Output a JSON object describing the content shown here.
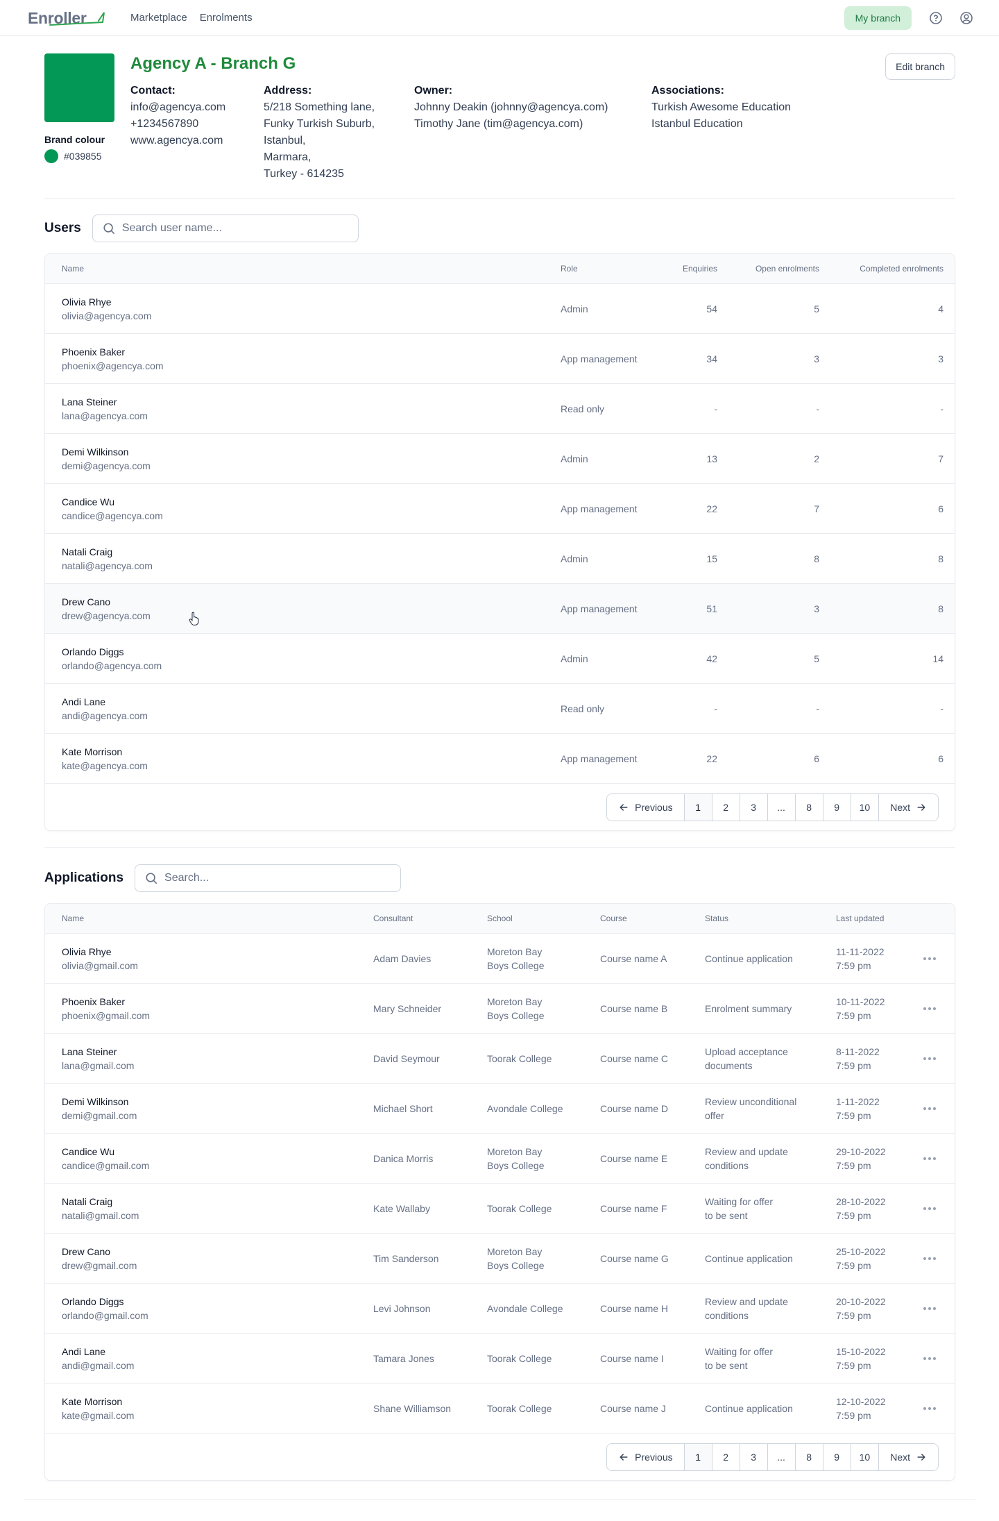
{
  "nav": {
    "logo": "Enroller",
    "links": [
      "Marketplace",
      "Enrolments"
    ],
    "branch_button": "My branch",
    "help_icon": "help-circle-icon",
    "user_icon": "user-circle-icon"
  },
  "branch": {
    "title": "Agency A - Branch G",
    "brand_colour_label": "Brand colour",
    "brand_colour": "#039855",
    "edit_button": "Edit branch",
    "contact": {
      "label": "Contact:",
      "lines": [
        "info@agencya.com",
        "+1234567890",
        "www.agencya.com"
      ]
    },
    "address": {
      "label": "Address:",
      "lines": [
        "5/218 Something lane,",
        "Funky Turkish Suburb,",
        "Istanbul,",
        "Marmara,",
        "Turkey - 614235"
      ]
    },
    "owner": {
      "label": "Owner:",
      "lines": [
        "Johnny Deakin (johnny@agencya.com)",
        "Timothy Jane (tim@agencya.com)"
      ]
    },
    "associations": {
      "label": "Associations:",
      "lines": [
        "Turkish Awesome Education",
        "Istanbul Education"
      ]
    }
  },
  "users": {
    "title": "Users",
    "search_placeholder": "Search user name...",
    "columns": [
      "Name",
      "Role",
      "Enquiries",
      "Open enrolments",
      "Completed enrolments"
    ],
    "rows": [
      {
        "name": "Olivia Rhye",
        "email": "olivia@agencya.com",
        "role": "Admin",
        "enquiries": "54",
        "open": "5",
        "completed": "4"
      },
      {
        "name": "Phoenix Baker",
        "email": "phoenix@agencya.com",
        "role": "App management",
        "enquiries": "34",
        "open": "3",
        "completed": "3"
      },
      {
        "name": "Lana Steiner",
        "email": "lana@agencya.com",
        "role": "Read only",
        "enquiries": "-",
        "open": "-",
        "completed": "-"
      },
      {
        "name": "Demi Wilkinson",
        "email": "demi@agencya.com",
        "role": "Admin",
        "enquiries": "13",
        "open": "2",
        "completed": "7"
      },
      {
        "name": "Candice Wu",
        "email": "candice@agencya.com",
        "role": "App management",
        "enquiries": "22",
        "open": "7",
        "completed": "6"
      },
      {
        "name": "Natali Craig",
        "email": "natali@agencya.com",
        "role": "Admin",
        "enquiries": "15",
        "open": "8",
        "completed": "8"
      },
      {
        "name": "Drew Cano",
        "email": "drew@agencya.com",
        "role": "App management",
        "enquiries": "51",
        "open": "3",
        "completed": "8"
      },
      {
        "name": "Orlando Diggs",
        "email": "orlando@agencya.com",
        "role": "Admin",
        "enquiries": "42",
        "open": "5",
        "completed": "14"
      },
      {
        "name": "Andi Lane",
        "email": "andi@agencya.com",
        "role": "Read only",
        "enquiries": "-",
        "open": "-",
        "completed": "-"
      },
      {
        "name": "Kate Morrison",
        "email": "kate@agencya.com",
        "role": "App management",
        "enquiries": "22",
        "open": "6",
        "completed": "6"
      }
    ]
  },
  "applications": {
    "title": "Applications",
    "search_placeholder": "Search...",
    "columns": [
      "Name",
      "Consultant",
      "School",
      "Course",
      "Status",
      "Last updated"
    ],
    "rows": [
      {
        "name": "Olivia Rhye",
        "email": "olivia@gmail.com",
        "consultant": "Adam Davies",
        "school": [
          "Moreton Bay",
          "Boys College"
        ],
        "course": "Course name A",
        "status": [
          "Continue application"
        ],
        "date": "11-11-2022",
        "time": "7:59 pm"
      },
      {
        "name": "Phoenix Baker",
        "email": "phoenix@gmail.com",
        "consultant": "Mary Schneider",
        "school": [
          "Moreton Bay",
          "Boys College"
        ],
        "course": "Course name B",
        "status": [
          "Enrolment summary"
        ],
        "date": "10-11-2022",
        "time": "7:59 pm"
      },
      {
        "name": "Lana Steiner",
        "email": "lana@gmail.com",
        "consultant": "David Seymour",
        "school": [
          "Toorak College"
        ],
        "course": "Course name C",
        "status": [
          "Upload acceptance",
          "documents"
        ],
        "date": "8-11-2022",
        "time": "7:59 pm"
      },
      {
        "name": "Demi Wilkinson",
        "email": "demi@gmail.com",
        "consultant": "Michael Short",
        "school": [
          "Avondale College"
        ],
        "course": "Course name D",
        "status": [
          "Review unconditional",
          "offer"
        ],
        "date": "1-11-2022",
        "time": "7:59 pm"
      },
      {
        "name": "Candice Wu",
        "email": "candice@gmail.com",
        "consultant": "Danica Morris",
        "school": [
          "Moreton Bay",
          "Boys College"
        ],
        "course": "Course name E",
        "status": [
          "Review and update",
          "conditions"
        ],
        "date": "29-10-2022",
        "time": "7:59 pm"
      },
      {
        "name": "Natali Craig",
        "email": "natali@gmail.com",
        "consultant": "Kate Wallaby",
        "school": [
          "Toorak College"
        ],
        "course": "Course name F",
        "status": [
          "Waiting for offer",
          "to be sent"
        ],
        "date": "28-10-2022",
        "time": "7:59 pm"
      },
      {
        "name": "Drew Cano",
        "email": "drew@gmail.com",
        "consultant": "Tim Sanderson",
        "school": [
          "Moreton Bay",
          "Boys College"
        ],
        "course": "Course name G",
        "status": [
          "Continue application"
        ],
        "date": "25-10-2022",
        "time": "7:59 pm"
      },
      {
        "name": "Orlando Diggs",
        "email": "orlando@gmail.com",
        "consultant": "Levi Johnson",
        "school": [
          "Avondale College"
        ],
        "course": "Course name H",
        "status": [
          "Review and update",
          "conditions"
        ],
        "date": "20-10-2022",
        "time": "7:59 pm"
      },
      {
        "name": "Andi Lane",
        "email": "andi@gmail.com",
        "consultant": "Tamara Jones",
        "school": [
          "Toorak College"
        ],
        "course": "Course name I",
        "status": [
          "Waiting for offer",
          "to be sent"
        ],
        "date": "15-10-2022",
        "time": "7:59 pm"
      },
      {
        "name": "Kate Morrison",
        "email": "kate@gmail.com",
        "consultant": "Shane Williamson",
        "school": [
          "Toorak College"
        ],
        "course": "Course name J",
        "status": [
          "Continue application"
        ],
        "date": "12-10-2022",
        "time": "7:59 pm"
      }
    ]
  },
  "pagination": {
    "previous": "Previous",
    "next": "Next",
    "pages": [
      "1",
      "2",
      "3",
      "...",
      "8",
      "9",
      "10"
    ],
    "current": "1"
  }
}
